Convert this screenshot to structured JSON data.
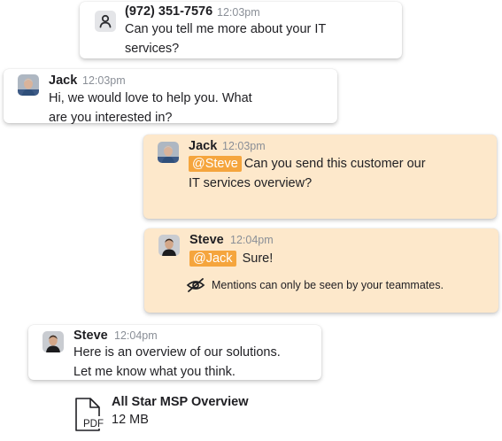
{
  "messages": [
    {
      "sender": "(972) 351-7576",
      "time": "12:03pm",
      "avatar": "contact-person-icon",
      "line1": "Can you tell me more about your IT",
      "line2": "services?"
    },
    {
      "sender": "Jack",
      "time": "12:03pm",
      "avatar": "jack-photo",
      "line1": "Hi, we would love to help you. What",
      "line2": "are you interested in?"
    },
    {
      "sender": "Jack",
      "time": "12:03pm",
      "avatar": "jack-photo",
      "mention": "@Steve",
      "line1": "Can you send this customer our",
      "line2": "IT services overview?"
    },
    {
      "sender": "Steve",
      "time": "12:04pm",
      "avatar": "steve-photo",
      "mention": "@Jack",
      "line1": "Sure!",
      "note": "Mentions can only be seen by your teammates.",
      "note_icon": "eye-slash-icon"
    },
    {
      "sender": "Steve",
      "time": "12:04pm",
      "avatar": "steve-photo",
      "line1": "Here is an overview of our solutions.",
      "line2": "Let me know what you think."
    }
  ],
  "attachment": {
    "icon": "pdf-file-icon",
    "icon_label": "PDF",
    "name": "All Star MSP Overview",
    "size": "12 MB"
  },
  "colors": {
    "internal_bubble": "#fde8cb",
    "mention_tag": "#f5a53d",
    "timestamp": "#8a8f97"
  }
}
